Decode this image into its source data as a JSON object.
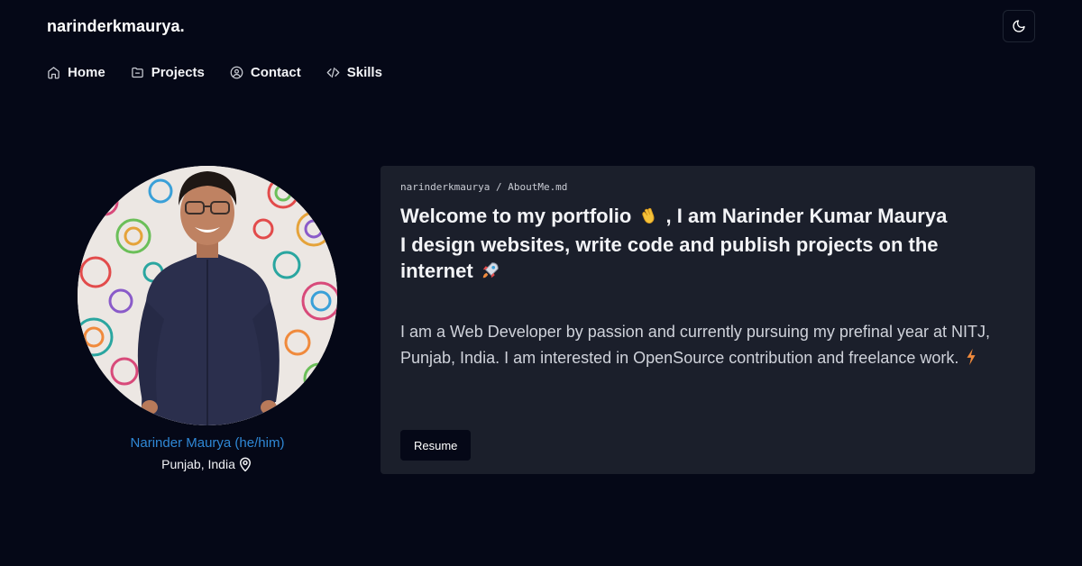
{
  "header": {
    "brand": "narinderkmaurya.",
    "theme_toggle_icon": "moon-icon"
  },
  "nav": {
    "items": [
      {
        "label": "Home",
        "icon": "home-icon"
      },
      {
        "label": "Projects",
        "icon": "folder-icon"
      },
      {
        "label": "Contact",
        "icon": "user-circle-icon"
      },
      {
        "label": "Skills",
        "icon": "code-icon"
      }
    ]
  },
  "profile": {
    "name": "Narinder Maurya (he/him)",
    "location": "Punjab, India",
    "location_icon": "map-pin-icon",
    "name_color": "#2f88d6"
  },
  "card": {
    "breadcrumb": "narinderkmaurya / AboutMe.md",
    "heading_line1_a": "Welcome to my portfolio",
    "heading_line1_b": ", I am Narinder Kumar Maurya",
    "heading_line2": "I design websites, write code and publish projects on the",
    "heading_line3": "internet",
    "about_a": "I am a Web Developer by passion and currently pursuing my prefinal year at NITJ, Punjab, India. I am interested in OpenSource contribution and freelance work.",
    "resume_label": "Resume",
    "emoji_wave": "waving-hand-icon",
    "emoji_rocket": "rocket-icon",
    "emoji_bolt": "lightning-icon"
  },
  "colors": {
    "background": "#050817",
    "card": "#1b1f2b",
    "accent": "#2f88d6"
  }
}
